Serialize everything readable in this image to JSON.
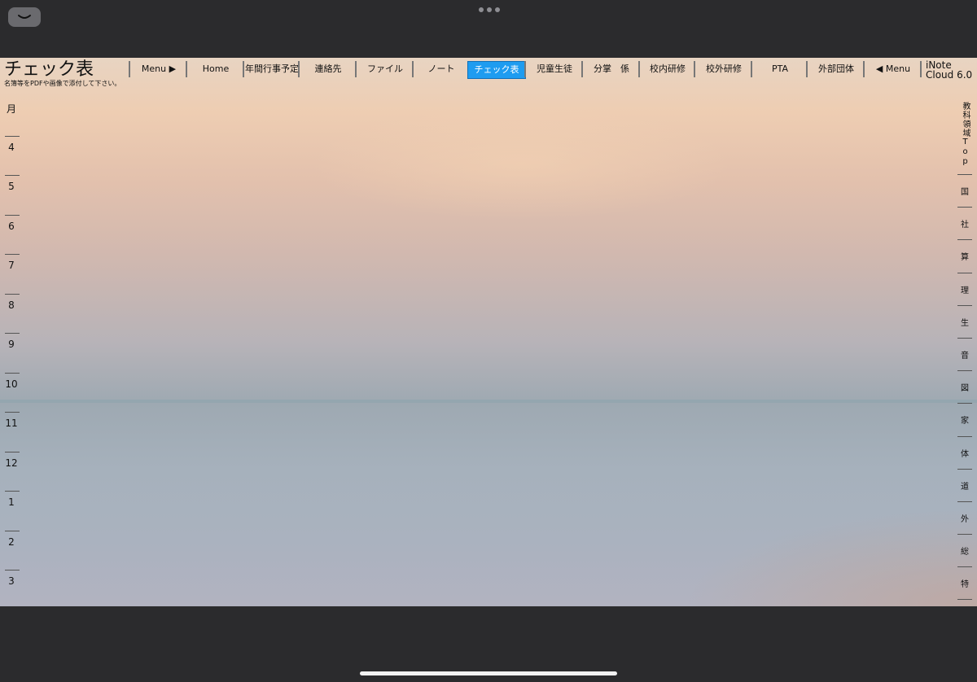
{
  "app": {
    "title": "チェック表",
    "subtitle": "名簿等をPDFや画像で添付して下さい。",
    "brand": [
      "iNote",
      "Cloud 6.0"
    ]
  },
  "nav": [
    {
      "label": "Menu ▶",
      "active": false
    },
    {
      "label": "Home",
      "active": false
    },
    {
      "label": "年間行事予定",
      "active": false
    },
    {
      "label": "連絡先",
      "active": false
    },
    {
      "label": "ファイル",
      "active": false
    },
    {
      "label": "ノート",
      "active": false
    },
    {
      "label": "チェック表",
      "active": true
    },
    {
      "label": "児童生徒",
      "active": false
    },
    {
      "label": "分掌　係",
      "active": false
    },
    {
      "label": "校内研修",
      "active": false
    },
    {
      "label": "校外研修",
      "active": false
    },
    {
      "label": "PTA",
      "active": false
    },
    {
      "label": "外部団体",
      "active": false
    },
    {
      "label": "◀ Menu",
      "active": false
    }
  ],
  "months": [
    "月",
    "4",
    "5",
    "6",
    "7",
    "8",
    "9",
    "10",
    "11",
    "12",
    "1",
    "2",
    "3"
  ],
  "subjects": [
    "教科領域Top",
    "国",
    "社",
    "算",
    "理",
    "生",
    "音",
    "図",
    "家",
    "体",
    "道",
    "外",
    "総",
    "特"
  ],
  "colors": {
    "active_tab": "#1e9cf0",
    "device_frame": "#2b2b2d"
  }
}
